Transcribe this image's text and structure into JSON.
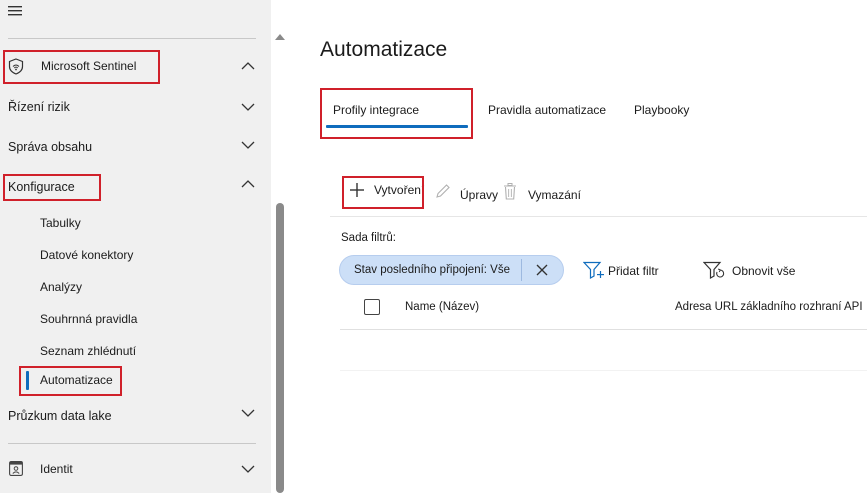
{
  "sidebar": {
    "hamburger_icon": "hamburger-icon",
    "sections": [
      {
        "label": "Microsoft Sentinel",
        "icon": "sentinel-shield-icon",
        "expanded": true
      },
      {
        "label": "Řízení rizik",
        "expanded": false
      },
      {
        "label": "Správa obsahu",
        "expanded": false
      },
      {
        "label": "Konfigurace",
        "expanded": true
      },
      {
        "label": "Průzkum data lake",
        "expanded": false
      },
      {
        "label": "Identit",
        "icon": "identity-card-icon",
        "expanded": false
      }
    ],
    "config_items": [
      "Tabulky",
      "Datové konektory",
      "Analýzy",
      "Souhrnná pravidla",
      "Seznam zhlédnutí",
      "Automatizace"
    ],
    "selected_item": "Automatizace",
    "selected_color": "#0f6cbd"
  },
  "main": {
    "title": "Automatizace",
    "tabs": [
      "Profily integrace",
      "Pravidla automatizace",
      "Playbooky"
    ],
    "active_tab": "Profily integrace",
    "toolbar": {
      "create": "Vytvoření",
      "edit": "Úpravy",
      "delete": "Vymazání"
    },
    "filter_set_label": "Sada filtrů:",
    "filter_pill": "Stav posledního připojení: Vše",
    "add_filter": "Přidat filtr",
    "reset_all": "Obnovit vše",
    "table": {
      "columns": [
        "Name (Název)",
        "Adresa URL základního rozhraní API"
      ]
    }
  },
  "colors": {
    "highlight_box": "#d0202a",
    "tab_underline": "#0f6cbd",
    "pill_bg": "#ccdff7",
    "sidebar_bg": "#f0f0f0"
  }
}
